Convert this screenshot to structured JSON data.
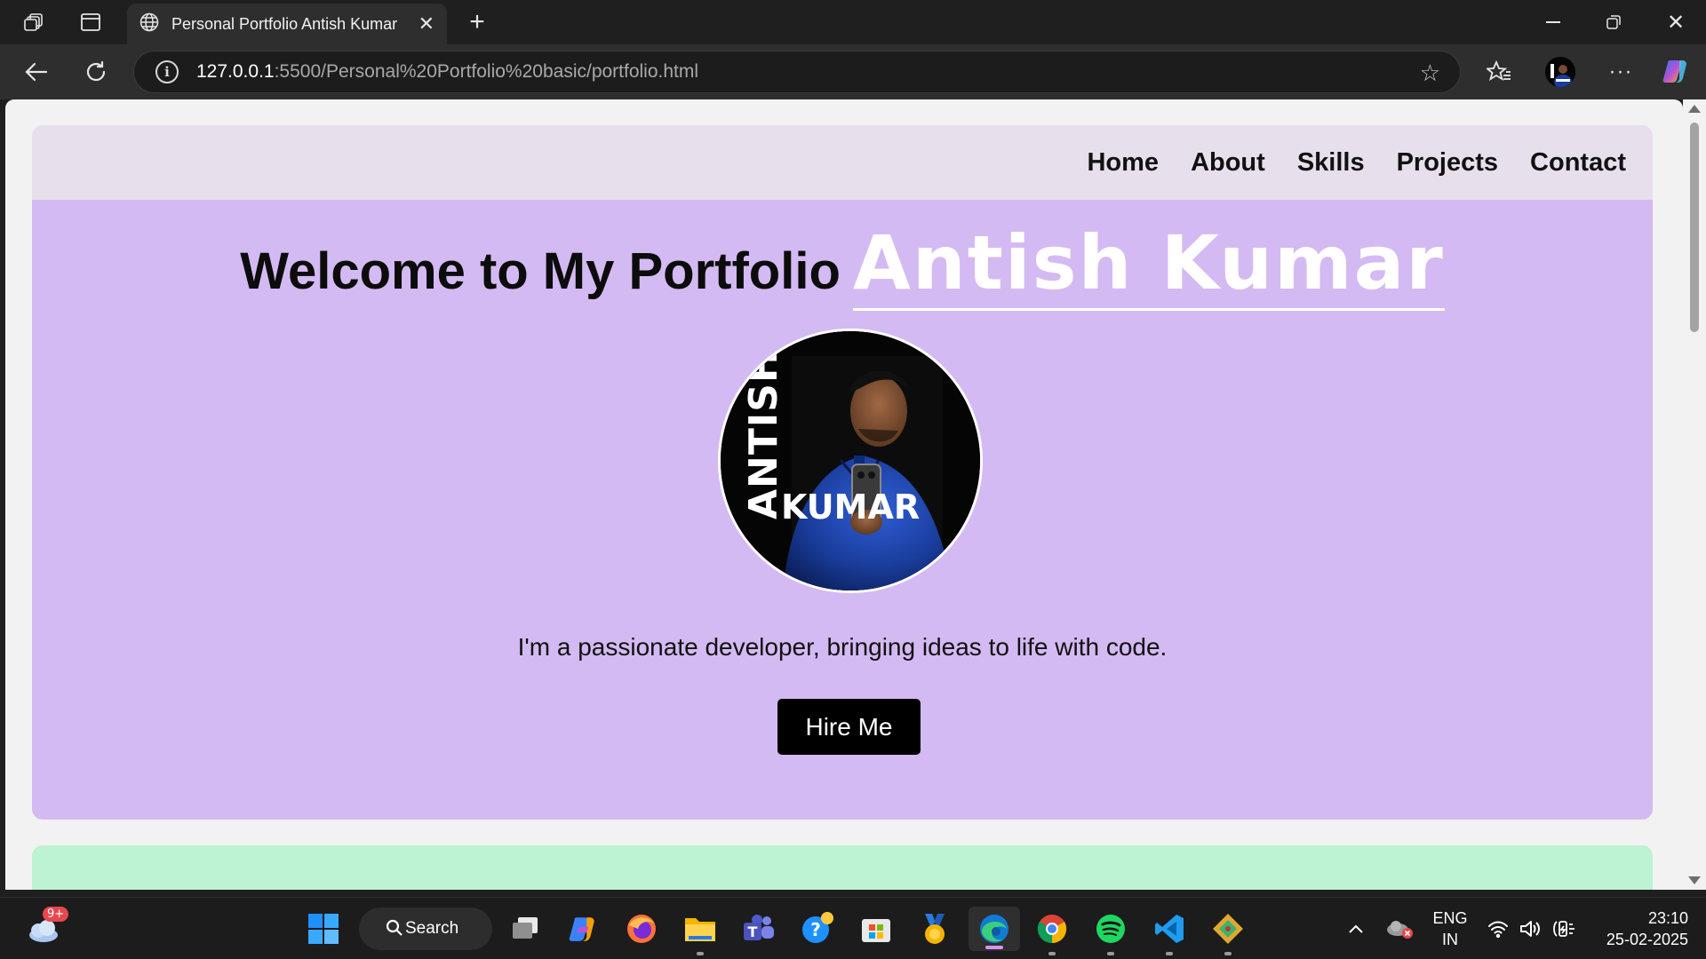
{
  "browser": {
    "tab_title": "Personal Portfolio Antish Kumar",
    "url_host": "127.0.0.1",
    "url_path": ":5500/Personal%20Portfolio%20basic/portfolio.html"
  },
  "nav": {
    "items": [
      "Home",
      "About",
      "Skills",
      "Projects",
      "Contact"
    ]
  },
  "hero": {
    "welcome": "Welcome to My Portfolio",
    "name": "Antish Kumar",
    "avatar_text_vertical": "ANTISH",
    "avatar_text_horizontal": "KUMAR",
    "tagline": "I'm a passionate developer, bringing ideas to life with code.",
    "cta_label": "Hire Me"
  },
  "taskbar": {
    "weather_badge": "9+",
    "search_label": "Search",
    "lang_top": "ENG",
    "lang_bottom": "IN",
    "time": "23:10",
    "date": "25-02-2025"
  },
  "colors": {
    "hero_bg": "#d4baf2",
    "navbar_bg": "#e7dfec",
    "next_section_bg": "#bdf2d2",
    "cta_bg": "#000000"
  }
}
